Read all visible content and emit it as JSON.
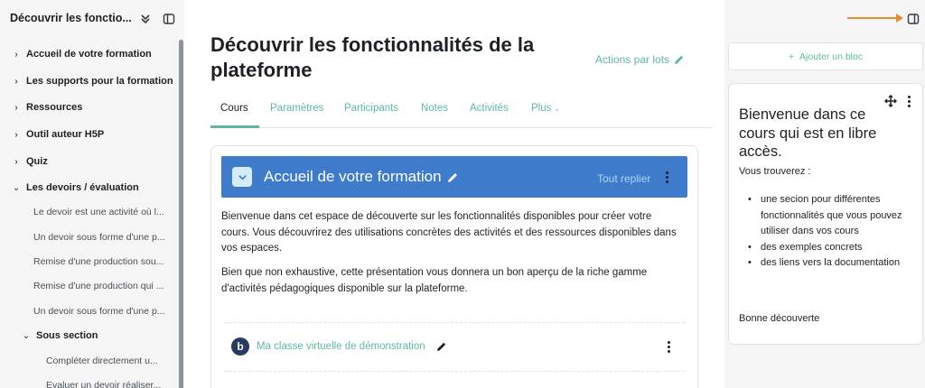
{
  "course_index": {
    "title": "Découvrir les fonctio...",
    "items": [
      {
        "label": "Accueil de votre formation",
        "kind": "section",
        "expanded": false
      },
      {
        "label": "Les supports pour la formation",
        "kind": "section",
        "expanded": false
      },
      {
        "label": "Ressources",
        "kind": "section",
        "expanded": false
      },
      {
        "label": "Outil auteur H5P",
        "kind": "section",
        "expanded": false
      },
      {
        "label": "Quiz",
        "kind": "section",
        "expanded": false
      },
      {
        "label": "Les devoirs / évaluation",
        "kind": "section",
        "expanded": true
      },
      {
        "label": "Le devoir est une activité où l...",
        "kind": "activity"
      },
      {
        "label": "Un devoir sous forme d'une p...",
        "kind": "activity"
      },
      {
        "label": "Remise d'une production sou...",
        "kind": "activity"
      },
      {
        "label": "Remise d'une production qui ...",
        "kind": "activity"
      },
      {
        "label": "Un devoir sous forme d'une p...",
        "kind": "activity"
      },
      {
        "label": "Sous section",
        "kind": "subsection",
        "expanded": true
      },
      {
        "label": "Compléter directement u...",
        "kind": "subactivity"
      },
      {
        "label": "Evaluer un devoir réaliser...",
        "kind": "subactivity"
      }
    ]
  },
  "header": {
    "title": "Découvrir les fonctionnalités de la plateforme",
    "bulk_actions": "Actions par lots"
  },
  "tabs": [
    "Cours",
    "Paramètres",
    "Participants",
    "Notes",
    "Activités",
    "Plus"
  ],
  "section": {
    "name": "Accueil de votre formation",
    "collapse_all": "Tout replier",
    "paragraphs": [
      "Bienvenue dans cet espace de découverte sur les fonctionnalités disponibles pour créer votre cours. Vous découvrirez des utilisations concrètes des activités et des ressources disponibles dans vos espaces.",
      "Bien que non exhaustive, cette présentation vous donnera un bon aperçu de la riche gamme d'activités pédagogiques disponible sur la plateforme."
    ],
    "activity": {
      "icon_letter": "b",
      "label": "Ma classe virtuelle de démonstration"
    }
  },
  "blocks": {
    "add_label": "Ajouter un bloc",
    "welcome": {
      "title": "Bienvenue dans ce cours qui est en libre accès.",
      "intro": "Vous trouverez :",
      "list": [
        "une secion pour différentes fonctionnalités que vous pouvez utiliser dans vos cours",
        "des exemples concrets",
        "des liens vers la documentation"
      ],
      "outro": "Bonne découverte"
    }
  },
  "colors": {
    "accent": "#5cb8a6",
    "section_bar": "#3e7bcb",
    "annotation_arrow": "#e0912f"
  }
}
